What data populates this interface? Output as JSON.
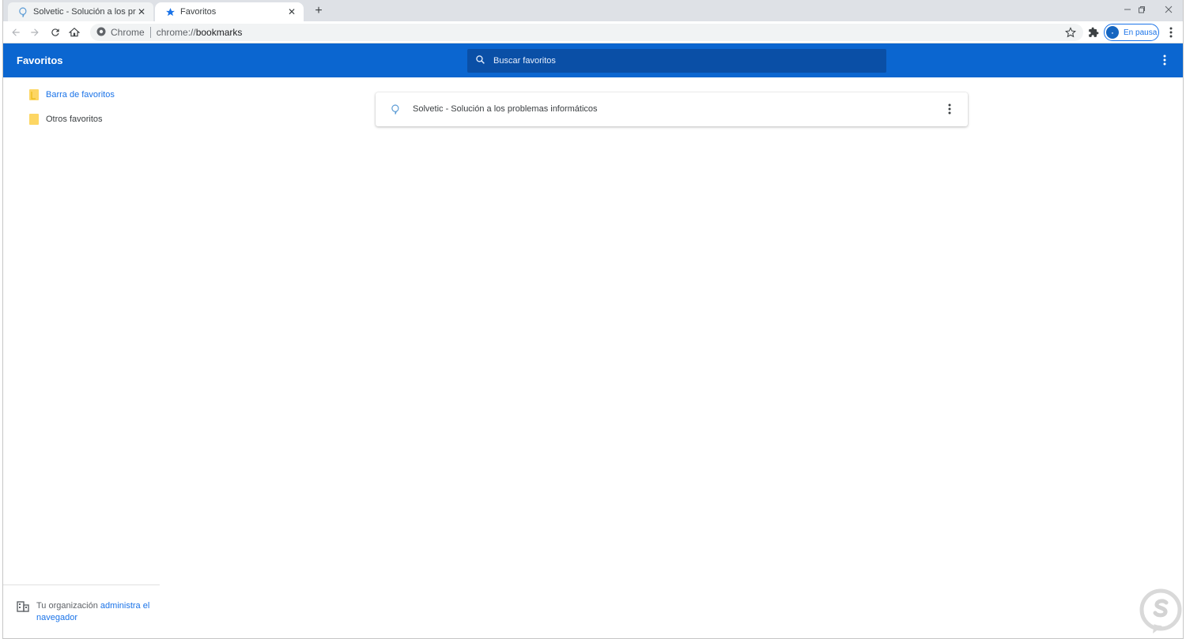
{
  "tabs": [
    {
      "label": "Solvetic - Solución a los problemas informáticos",
      "icon": "solvetic-favicon",
      "active": false
    },
    {
      "label": "Favoritos",
      "icon": "star-icon",
      "active": true
    }
  ],
  "window_controls": [
    "minimize",
    "restore",
    "close"
  ],
  "toolbar": {
    "site_chip": "Chrome",
    "url_scheme": "chrome://",
    "url_host": "bookmarks",
    "profile_label": "En pausa"
  },
  "bookmarks_app": {
    "title": "Favoritos",
    "search_placeholder": "Buscar favoritos"
  },
  "sidebar": {
    "folders": [
      {
        "label": "Barra de favoritos",
        "selected": true
      },
      {
        "label": "Otros favoritos",
        "selected": false
      }
    ]
  },
  "bookmarks": [
    {
      "title": "Solvetic - Solución a los problemas informáticos"
    }
  ],
  "managed_notice": {
    "text": "Tu organización ",
    "link": "administra el navegador"
  },
  "colors": {
    "header_blue": "#0b66d0",
    "search_blue": "#0a4fa6",
    "link_blue": "#1a73e8",
    "folder_yellow": "#fdd663"
  }
}
